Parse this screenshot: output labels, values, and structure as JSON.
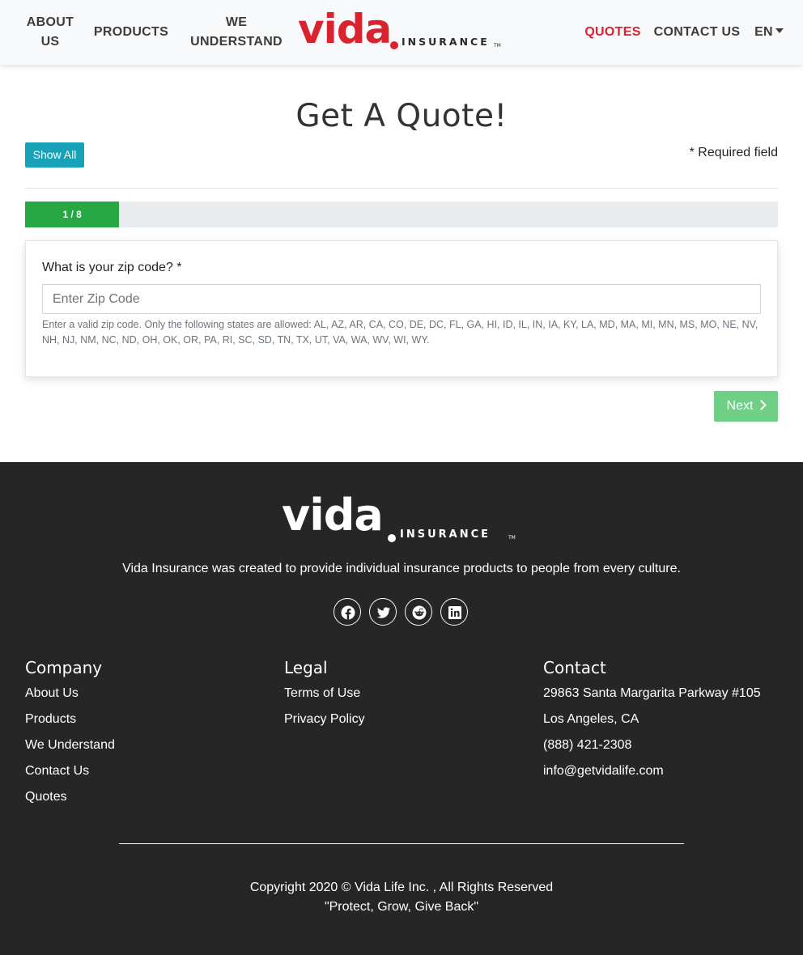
{
  "nav": {
    "about": "ABOUT US",
    "products": "PRODUCTS",
    "we_understand": "WE UNDERSTAND",
    "quotes": "QUOTES",
    "contact": "CONTACT US",
    "language": "EN"
  },
  "logo": {
    "word": "vida",
    "sub": "INSURANCE",
    "tm": "TM"
  },
  "main": {
    "title": "Get A Quote!",
    "show_all_label": "Show All",
    "required_note": "* Required field",
    "progress": {
      "label": "1 / 8",
      "current": 1,
      "total": 8,
      "fraction": 0.125
    },
    "question": "What is your zip code? *",
    "zip_placeholder": "Enter Zip Code",
    "zip_value": "",
    "help_text": "Enter a valid zip code. Only the following states are allowed: AL, AZ, AR, CA, CO, DE, DC, FL, GA, HI, ID, IL, IN, IA, KY, LA, MD, MA, MI, MN, MS, MO, NE, NV, NH, NJ, NM, NC, ND, OH, OK, OR, PA, RI, SC, SD, TN, TX, UT, VA, WA, WV, WI, WY.",
    "next_label": "Next"
  },
  "footer": {
    "tagline": "Vida Insurance was created to provide individual insurance products to people from every culture.",
    "social_icons": [
      "facebook-icon",
      "twitter-icon",
      "reddit-icon",
      "linkedin-icon"
    ],
    "company": {
      "heading": "Company",
      "links": [
        "About Us",
        "Products",
        "We Understand",
        "Contact Us",
        "Quotes"
      ]
    },
    "legal": {
      "heading": "Legal",
      "links": [
        "Terms of Use",
        "Privacy Policy"
      ]
    },
    "contact": {
      "heading": "Contact",
      "address": "29863 Santa Margarita Parkway #105",
      "city": "Los Angeles, CA",
      "phone": "(888) 421-2308",
      "email": "info@getvidalife.com"
    },
    "copyright": "Copyright 2020 © Vida Life Inc. , All Rights Reserved",
    "motto": "\"Protect, Grow, Give Back\""
  },
  "colors": {
    "brand_red": "#d9232e",
    "progress_green": "#28a745",
    "next_green": "#6fcf84",
    "teal": "#17a2b8",
    "footer_bg": "#262626"
  }
}
